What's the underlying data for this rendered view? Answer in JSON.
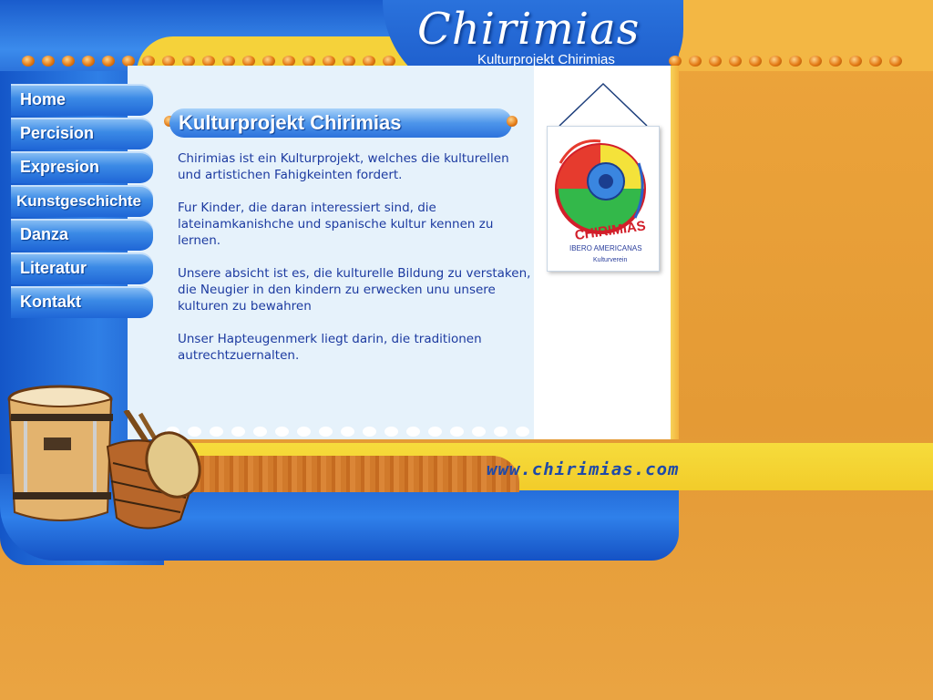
{
  "brand": {
    "title": "Chirimias",
    "subtitle": "Kulturprojekt Chirimias",
    "url": "www.chirimias.com"
  },
  "nav": {
    "items": [
      {
        "label": "Home"
      },
      {
        "label": "Percision"
      },
      {
        "label": "Expresion"
      },
      {
        "label": "Kunstgeschichte"
      },
      {
        "label": "Danza"
      },
      {
        "label": "Literatur"
      },
      {
        "label": "Kontakt"
      }
    ]
  },
  "main": {
    "heading": "Kulturprojekt Chirimias",
    "paragraphs": [
      "Chirimias ist ein Kulturprojekt, welches die kulturellen und artistichen Fahigkeinten fordert.",
      "Fur Kinder, die daran interessiert sind, die lateinamkanishche und spanische kultur kennen zu lernen.",
      "Unsere absicht ist es, die kulturelle Bildung zu verstaken, die Neugier in den kindern zu erwecken unu unsere kulturen zu bewahren",
      "Unser Hapteugenmerk liegt darin, die traditionen autrechtzuernalten."
    ]
  },
  "poster": {
    "text_main": "CHIRIMIAS",
    "text_sub": "IBERO AMERICANAS",
    "text_small": "Kulturverein"
  },
  "colors": {
    "blue": "#1f62d0",
    "orange": "#e8a23a",
    "yellow": "#f5d23a",
    "panel": "#e6f2fb",
    "text": "#1c3aa0"
  }
}
